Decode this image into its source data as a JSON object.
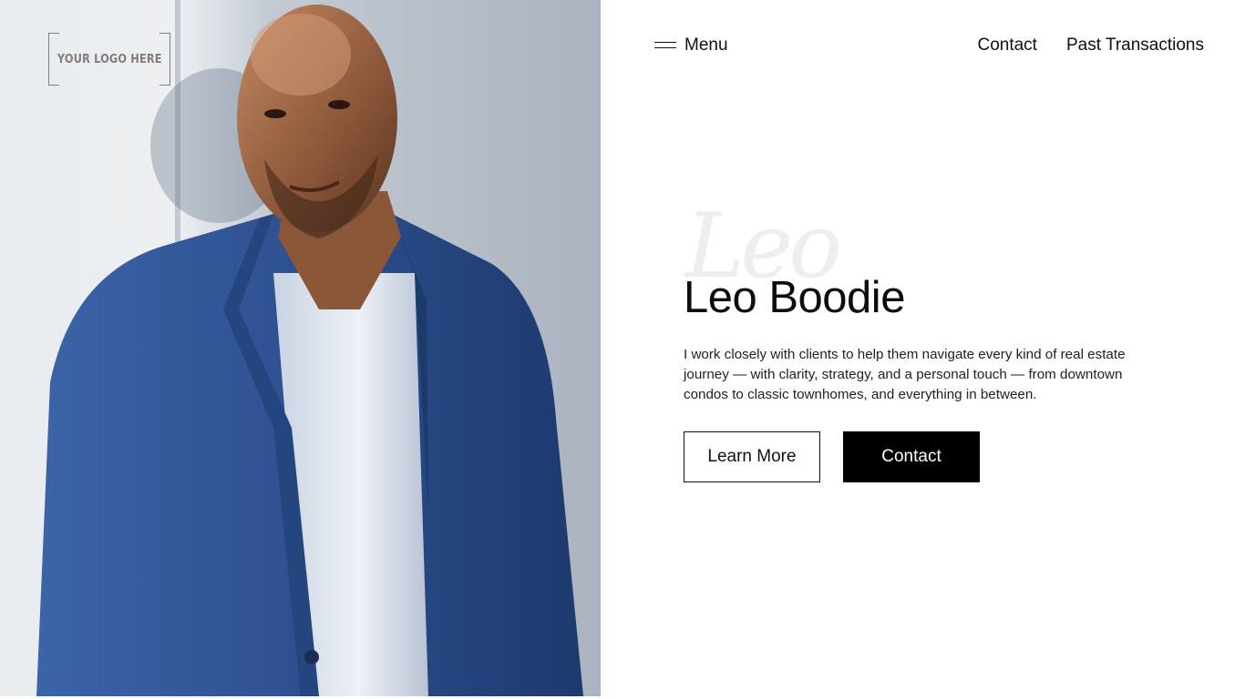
{
  "logo": {
    "text": "YOUR LOGO HERE"
  },
  "nav": {
    "menu_label": "Menu",
    "links": [
      "Contact",
      "Past Transactions"
    ]
  },
  "hero": {
    "script_text": "Leo",
    "name": "Leo Boodie",
    "bio": "I work closely with clients to help them navigate every kind of real estate journey — with clarity, strategy, and a personal touch — from downtown condos to classic townhomes, and everything in between.",
    "primary_button": "Learn More",
    "secondary_button": "Contact"
  },
  "colors": {
    "background": "#ffffff",
    "text": "#111111",
    "button_dark": "#000000",
    "jacket_blue": "#2c4f8f",
    "wall": "#e3e6ea"
  }
}
